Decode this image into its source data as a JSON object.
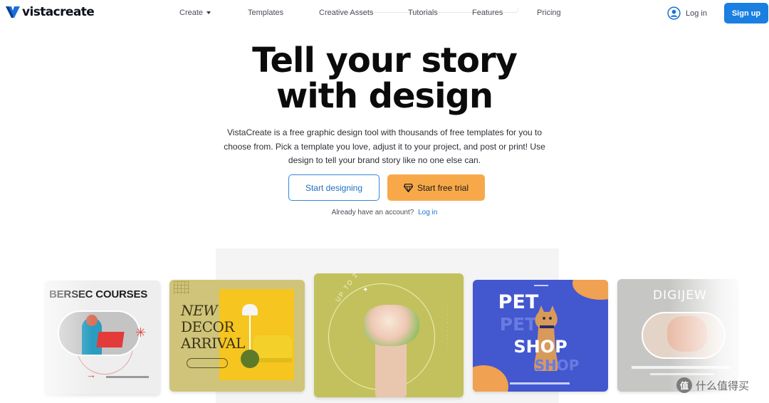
{
  "brand": {
    "logo_text": "vistacreate",
    "accent": "#1a7fe0",
    "cta_orange": "#f7a94a"
  },
  "nav": {
    "items": [
      {
        "label": "Create",
        "has_caret": true
      },
      {
        "label": "Templates"
      },
      {
        "label": "Creative Assets"
      },
      {
        "label": "Tutorials"
      },
      {
        "label": "Features"
      },
      {
        "label": "Pricing"
      }
    ],
    "login_label": "Log in",
    "signup_label": "Sign up"
  },
  "hero": {
    "title_line1": "Tell your story",
    "title_line2": "with design",
    "description_line1": "VistaCreate is a free graphic design tool with thousands of free templates for you to",
    "description_line2": "choose from. Pick a template you love, adjust it to your project, and post or print! Use",
    "description_line3": "design to tell your brand story like no one else can.",
    "btn_design": "Start designing",
    "btn_trial": "Start free trial",
    "account_prompt": "Already have an account?",
    "account_link": "Log in"
  },
  "templates": {
    "card1": {
      "title": "BERSEC COURSES"
    },
    "card2": {
      "line1": "NEW",
      "line2": "DECOR",
      "line3": "ARRIVAL"
    },
    "card3": {
      "arc_text": "UP TO 20% OFF CLEANING SERVICE"
    },
    "card4": {
      "line1": "PET",
      "line2": "SHOP"
    },
    "card5": {
      "title": "DIGIJEW"
    }
  },
  "watermark": {
    "icon": "值",
    "text": "什么值得买"
  }
}
